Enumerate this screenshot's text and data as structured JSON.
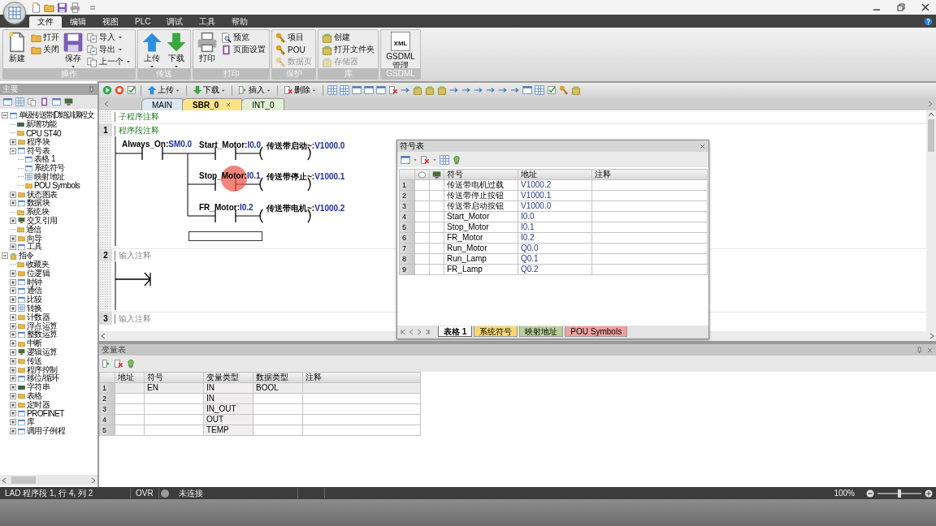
{
  "menu_tabs": [
    {
      "label": "文件",
      "selected": true
    },
    {
      "label": "编辑",
      "selected": false
    },
    {
      "label": "视图",
      "selected": false
    },
    {
      "label": "PLC",
      "selected": false
    },
    {
      "label": "调试",
      "selected": false
    },
    {
      "label": "工具",
      "selected": false
    },
    {
      "label": "帮助",
      "selected": false
    }
  ],
  "ribbon": [
    {
      "title": "操作",
      "buttons": [
        {
          "label": "新建",
          "kind": "large",
          "dropdown": false,
          "disabled": false
        },
        {
          "label": "打开",
          "kind": "small",
          "dropdown": false,
          "disabled": false
        },
        {
          "label": "关闭",
          "kind": "small",
          "dropdown": false,
          "disabled": false
        },
        {
          "label": "保存",
          "kind": "large",
          "dropdown": true,
          "disabled": false
        },
        {
          "label": "导入",
          "kind": "small",
          "dropdown": true,
          "disabled": false
        },
        {
          "label": "导出",
          "kind": "small",
          "dropdown": true,
          "disabled": false
        },
        {
          "label": "上一个",
          "kind": "small",
          "dropdown": true,
          "disabled": false
        }
      ]
    },
    {
      "title": "传送",
      "buttons": [
        {
          "label": "上传",
          "kind": "large",
          "dropdown": true,
          "disabled": false
        },
        {
          "label": "下载",
          "kind": "large",
          "dropdown": true,
          "disabled": false
        }
      ]
    },
    {
      "title": "打印",
      "buttons": [
        {
          "label": "打印",
          "kind": "large",
          "dropdown": false,
          "disabled": false
        },
        {
          "label": "预览",
          "kind": "small",
          "dropdown": false,
          "disabled": false
        },
        {
          "label": "页面设置",
          "kind": "small",
          "dropdown": false,
          "disabled": false
        }
      ]
    },
    {
      "title": "保护",
      "buttons": [
        {
          "label": "项目",
          "kind": "small",
          "dropdown": false,
          "disabled": false
        },
        {
          "label": "POU",
          "kind": "small",
          "dropdown": false,
          "disabled": false
        },
        {
          "label": "数据页",
          "kind": "small",
          "dropdown": false,
          "disabled": true
        }
      ]
    },
    {
      "title": "库",
      "buttons": [
        {
          "label": "创建",
          "kind": "small",
          "dropdown": false,
          "disabled": false
        },
        {
          "label": "打开文件夹",
          "kind": "small",
          "dropdown": false,
          "disabled": false
        },
        {
          "label": "存储器",
          "kind": "small",
          "dropdown": false,
          "disabled": true
        }
      ]
    },
    {
      "title": "GSDML",
      "buttons": [
        {
          "label": "GSDML 管理",
          "kind": "large",
          "dropdown": false,
          "disabled": false,
          "icon_text": "XML"
        }
      ]
    }
  ],
  "project_tree": {
    "title": "主要",
    "items": [
      {
        "label": "单级传送带 (D:\\培训课程文",
        "expanded": true,
        "children": [
          {
            "label": "新增功能"
          },
          {
            "label": "CPU ST40"
          },
          {
            "label": "程序块",
            "expanded": false
          },
          {
            "label": "符号表",
            "expanded": true,
            "children": [
              {
                "label": "表格 1"
              },
              {
                "label": "系统符号"
              },
              {
                "label": "映射地址"
              },
              {
                "label": "POU Symbols"
              }
            ]
          },
          {
            "label": "状态图表",
            "expanded": false
          },
          {
            "label": "数据块",
            "expanded": false
          },
          {
            "label": "系统块"
          },
          {
            "label": "交叉引用",
            "expanded": false
          },
          {
            "label": "通信"
          },
          {
            "label": "向导",
            "expanded": false
          },
          {
            "label": "工具",
            "expanded": false
          }
        ]
      },
      {
        "label": "指令",
        "expanded": true,
        "children": [
          {
            "label": "收藏夹"
          },
          {
            "label": "位逻辑",
            "expanded": false
          },
          {
            "label": "时钟",
            "expanded": false
          },
          {
            "label": "通信",
            "expanded": false
          },
          {
            "label": "比较",
            "expanded": false
          },
          {
            "label": "转换",
            "expanded": false
          },
          {
            "label": "计数器",
            "expanded": false
          },
          {
            "label": "浮点运算",
            "expanded": false
          },
          {
            "label": "整数运算",
            "expanded": false
          },
          {
            "label": "中断",
            "expanded": false
          },
          {
            "label": "逻辑运算",
            "expanded": false
          },
          {
            "label": "传送",
            "expanded": false
          },
          {
            "label": "程序控制",
            "expanded": false
          },
          {
            "label": "移位/循环",
            "expanded": false
          },
          {
            "label": "字符串",
            "expanded": false
          },
          {
            "label": "表格",
            "expanded": false
          },
          {
            "label": "定时器",
            "expanded": false
          },
          {
            "label": "PROFINET",
            "expanded": false
          },
          {
            "label": "库",
            "expanded": false
          },
          {
            "label": "调用子例程",
            "expanded": false
          }
        ]
      }
    ]
  },
  "editor": {
    "toolbar": [
      {
        "label": "上传"
      },
      {
        "label": "下载"
      },
      {
        "label": "插入"
      },
      {
        "label": "删除"
      }
    ],
    "tabs": [
      {
        "label": "MAIN",
        "selected": false,
        "closable": false,
        "color": "#dde8f4"
      },
      {
        "label": "SBR_0",
        "selected": true,
        "closable": true,
        "color": "#fbe38a"
      },
      {
        "label": "INT_0",
        "selected": false,
        "closable": false,
        "color": "#e2efd5"
      }
    ],
    "subroutine_comment": "子程序注释",
    "networks": [
      {
        "number": "1",
        "comment": "程序段注释",
        "kind": "ladder",
        "input": {
          "symbol": "Always_On:",
          "address": "SM0.0"
        },
        "branches": [
          {
            "contact": {
              "symbol": "Start_Motor:",
              "address": "I0.0"
            },
            "coil": {
              "symbol": "传送带启动~:",
              "address": "V1000.0"
            }
          },
          {
            "contact": {
              "symbol": "Stop_Motor:",
              "address": "I0.1"
            },
            "coil": {
              "symbol": "传送带停止~:",
              "address": "V1000.1"
            }
          },
          {
            "contact": {
              "symbol": "FR_Motor:",
              "address": "I0.2"
            },
            "coil": {
              "symbol": "传送带电机~:",
              "address": "V1000.2"
            }
          }
        ]
      },
      {
        "number": "2",
        "comment": "输入注释",
        "kind": "open"
      },
      {
        "number": "3",
        "comment": "输入注释",
        "kind": "header"
      }
    ]
  },
  "symbol_table": {
    "title": "符号表",
    "columns": [
      "符号",
      "地址",
      "注释"
    ],
    "rows": [
      {
        "number": "1",
        "symbol": "传送带电机过载",
        "address": "V1000.2"
      },
      {
        "number": "2",
        "symbol": "传送带停止按钮",
        "address": "V1000.1"
      },
      {
        "number": "3",
        "symbol": "传送带启动按钮",
        "address": "V1000.0"
      },
      {
        "number": "4",
        "symbol": "Start_Motor",
        "address": "I0.0"
      },
      {
        "number": "5",
        "symbol": "Stop_Motor",
        "address": "I0.1"
      },
      {
        "number": "6",
        "symbol": "FR_Motor",
        "address": "I0.2"
      },
      {
        "number": "7",
        "symbol": "Run_Motor",
        "address": "Q0.0"
      },
      {
        "number": "8",
        "symbol": "Run_Lamp",
        "address": "Q0.1"
      },
      {
        "number": "9",
        "symbol": "FR_Lamp",
        "address": "Q0.2"
      }
    ],
    "sheets": [
      {
        "label": "表格 1",
        "selected": true,
        "color": "#ffffff"
      },
      {
        "label": "系统符号",
        "selected": false,
        "color": "#f7d774"
      },
      {
        "label": "映射地址",
        "selected": false,
        "color": "#b9cf9a"
      },
      {
        "label": "POU Symbols",
        "selected": false,
        "color": "#f0a0a0"
      }
    ]
  },
  "variable_table": {
    "title": "变量表",
    "columns": [
      "地址",
      "符号",
      "变量类型",
      "数据类型",
      "注释"
    ],
    "rows": [
      {
        "number": "1",
        "symbol": "EN",
        "var_type": "IN",
        "data_type": "BOOL",
        "selected": true
      },
      {
        "number": "2",
        "var_type": "IN",
        "selected": false
      },
      {
        "number": "3",
        "var_type": "IN_OUT",
        "selected": false
      },
      {
        "number": "4",
        "var_type": "OUT",
        "selected": false
      },
      {
        "number": "5",
        "var_type": "TEMP",
        "selected": false
      }
    ]
  },
  "status_bar": {
    "position": "LAD 程序段 1, 行 4, 列 2",
    "mode": "OVR",
    "connected": false,
    "connection": "未连接",
    "zoom": {
      "label": "100%",
      "level": 0.5
    }
  }
}
